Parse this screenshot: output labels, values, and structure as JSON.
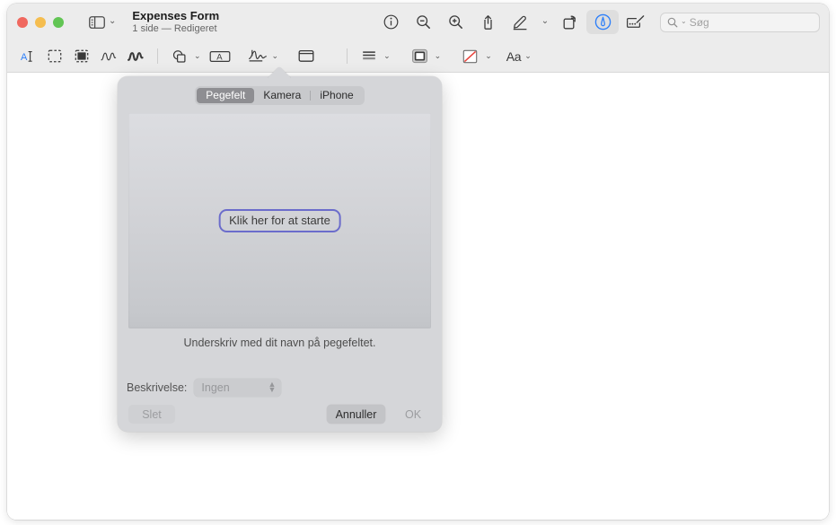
{
  "window": {
    "traffic_lights": [
      {
        "name": "close",
        "color": "#f0685f"
      },
      {
        "name": "minimize",
        "color": "#f5bd4f"
      },
      {
        "name": "zoom",
        "color": "#62c554"
      }
    ],
    "title": "Expenses Form",
    "subtitle": "1 side — Redigeret"
  },
  "toolbar": {
    "sidebar_button": "sidebar-icon",
    "sidebar_chevron": "⌄",
    "right_items": [
      {
        "name": "info-icon",
        "label": "Info"
      },
      {
        "name": "zoom-out-icon",
        "label": "Zoom ud"
      },
      {
        "name": "zoom-in-icon",
        "label": "Zoom ind"
      },
      {
        "name": "share-icon",
        "label": "Del"
      },
      {
        "name": "markup-pen-icon",
        "label": "Marker"
      },
      {
        "name": "rotate-icon",
        "label": "Rotér"
      },
      {
        "name": "annotate-circle-icon",
        "label": "Marker op",
        "selected": true
      },
      {
        "name": "signature-toolbar-icon",
        "label": "Underskrift"
      }
    ],
    "search": {
      "placeholder": "Søg",
      "icon": "search-icon",
      "chevron": "⌄"
    }
  },
  "markup_toolbar": {
    "items": [
      {
        "name": "text-selection-tool",
        "label": "Tekstvalg"
      },
      {
        "name": "rectangular-selection-tool",
        "label": "Rektangulært valg"
      },
      {
        "name": "instant-alpha-tool",
        "label": "Instant Alpha"
      },
      {
        "name": "sketch-tool",
        "label": "Skitse"
      },
      {
        "name": "draw-tool",
        "label": "Tegn"
      },
      {
        "name": "shapes-tool",
        "label": "Figurer",
        "chevron": "⌄"
      },
      {
        "name": "text-tool",
        "label": "Tekst"
      },
      {
        "name": "signature-tool",
        "label": "Underskriv",
        "chevron": "⌄",
        "active": true
      },
      {
        "name": "note-tool",
        "label": "Note"
      },
      {
        "name": "align-tool",
        "label": "Justering",
        "chevron": "⌄"
      },
      {
        "name": "border-style-tool",
        "label": "Kantstil",
        "chevron": "⌄"
      },
      {
        "name": "fill-color-tool",
        "label": "Fyldfarve",
        "chevron": "⌄"
      },
      {
        "name": "font-tool",
        "label": "Aa",
        "chevron": "⌄"
      }
    ]
  },
  "popover": {
    "tabs": [
      {
        "label": "Pegefelt",
        "active": true
      },
      {
        "label": "Kamera",
        "active": false
      },
      {
        "label": "iPhone",
        "active": false
      }
    ],
    "start_button": "Klik her for at starte",
    "caption": "Underskriv med dit navn på pegefeltet.",
    "description": {
      "label": "Beskrivelse:",
      "value": "Ingen",
      "stepper_up": "▲",
      "stepper_down": "▼"
    },
    "buttons": {
      "delete": "Slet",
      "cancel": "Annuller",
      "ok": "OK"
    },
    "colors": {
      "accent_border": "#6b6ccb",
      "popover_bg": "#d5d6d9",
      "pad_top": "#dcdde1",
      "pad_bottom": "#c2c4c8"
    }
  }
}
